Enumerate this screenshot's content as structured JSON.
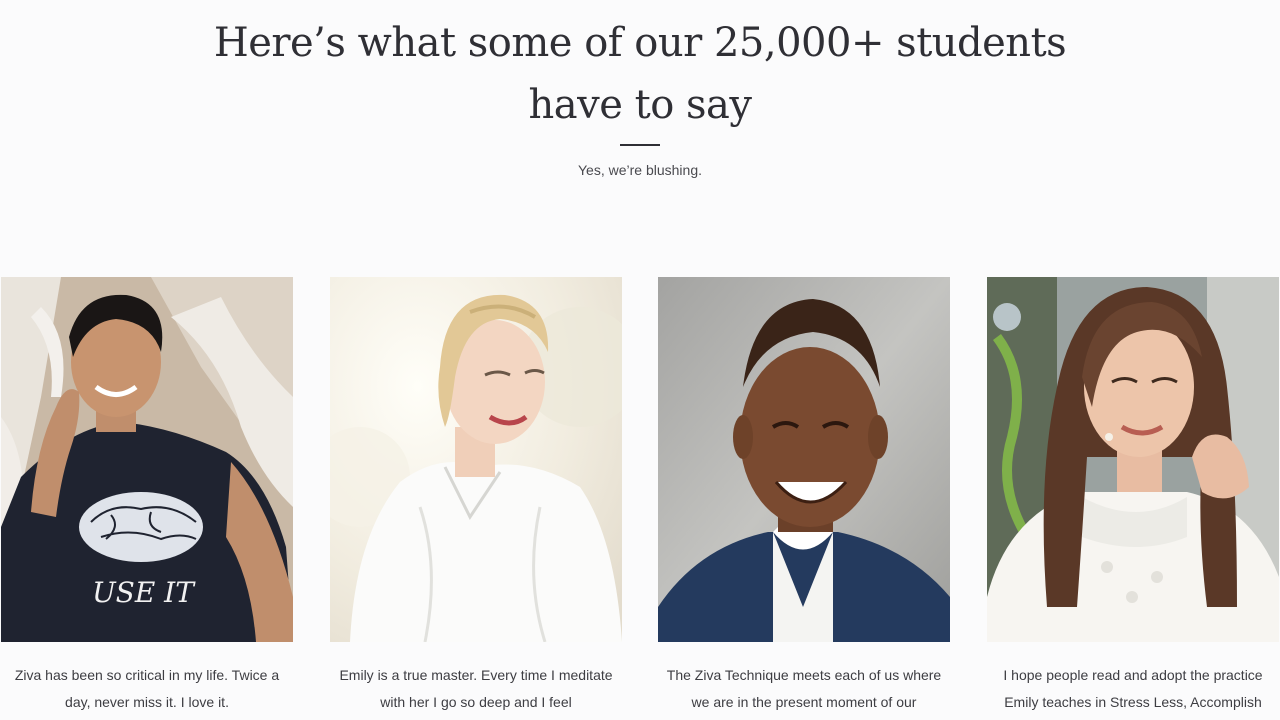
{
  "header": {
    "title_line1": "Here’s what some of our 25,000+ students",
    "title_line2": "have to say",
    "subtitle": "Yes, we’re blushing."
  },
  "testimonials": [
    {
      "photo": "man-in-brain-tshirt-photo",
      "shirt_text": "USE IT",
      "quote": "Ziva has been so critical in my life. Twice a day, never miss it. I love it."
    },
    {
      "photo": "blonde-woman-white-blouse-photo",
      "quote": "Emily is a true master. Every time I meditate with her I go so deep and I feel"
    },
    {
      "photo": "smiling-man-navy-suit-photo",
      "quote": "The Ziva Technique meets each of us where we are in the present moment of our"
    },
    {
      "photo": "brunette-woman-lace-top-photo",
      "quote": "I hope people read and adopt the practice Emily teaches in Stress Less, Accomplish"
    }
  ]
}
